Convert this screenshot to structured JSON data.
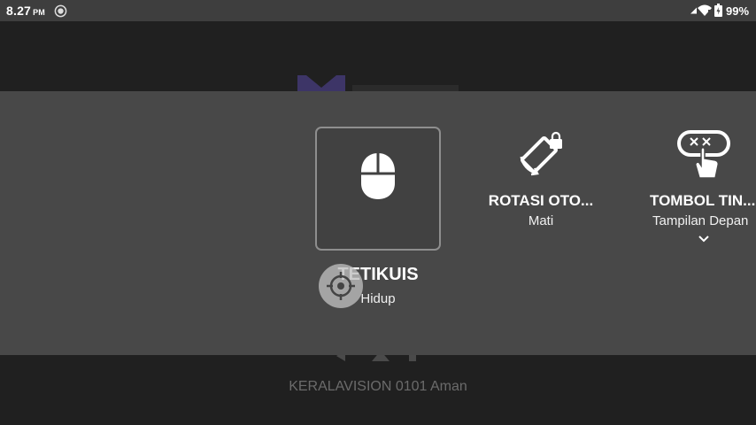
{
  "status_bar": {
    "time": "8.27",
    "ampm": "PM",
    "battery": "99%",
    "icons": [
      "sync-icon",
      "signal-icon",
      "wifi-icon",
      "battery-icon"
    ]
  },
  "background": {
    "network_status": "KERALAVISION 0101 Aman"
  },
  "quick_settings": {
    "tiles": [
      {
        "title": "TETIKUIS",
        "subtitle": "Hidup",
        "icon": "mouse-icon",
        "selected": true
      },
      {
        "title": "ROTASI OTO...",
        "subtitle": "Mati",
        "icon": "screen-rotation-lock-icon"
      },
      {
        "title": "TOMBOL TIN...",
        "subtitle": "Tampilan Depan",
        "icon": "touch-button-icon",
        "expandable": true
      }
    ]
  },
  "colors": {
    "panel": "#484848",
    "statusbar": "#3e3e3e",
    "background": "#202020"
  }
}
